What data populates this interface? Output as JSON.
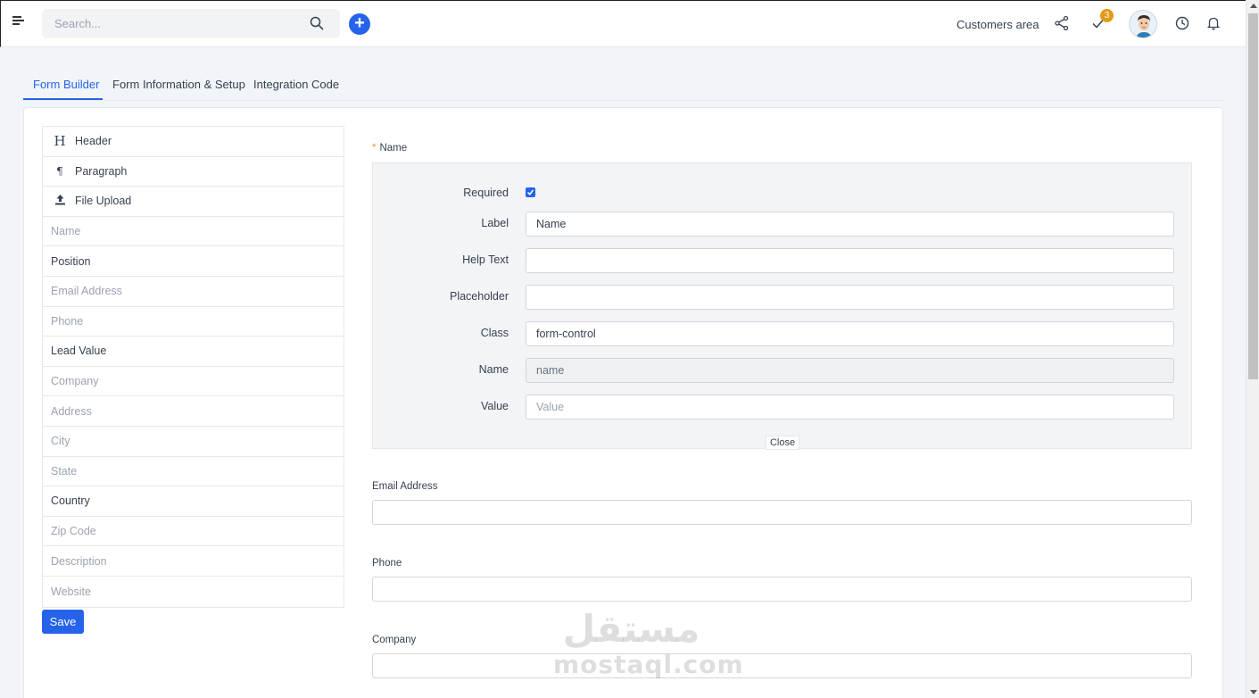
{
  "topbar": {
    "search_placeholder": "Search...",
    "customers_area": "Customers area",
    "tasks_badge": "3"
  },
  "tabs": [
    {
      "label": "Form Builder",
      "active": true
    },
    {
      "label": "Form Information & Setup",
      "active": false
    },
    {
      "label": "Integration Code",
      "active": false
    }
  ],
  "fields": [
    {
      "label": "Header",
      "icon": "header-icon",
      "style": "dark"
    },
    {
      "label": "Paragraph",
      "icon": "paragraph-icon",
      "style": "dark"
    },
    {
      "label": "File Upload",
      "icon": "upload-icon",
      "style": "dark"
    },
    {
      "label": "Name",
      "style": "light"
    },
    {
      "label": "Position",
      "style": "dark"
    },
    {
      "label": "Email Address",
      "style": "light"
    },
    {
      "label": "Phone",
      "style": "light"
    },
    {
      "label": "Lead Value",
      "style": "dark"
    },
    {
      "label": "Company",
      "style": "light"
    },
    {
      "label": "Address",
      "style": "light"
    },
    {
      "label": "City",
      "style": "light"
    },
    {
      "label": "State",
      "style": "light"
    },
    {
      "label": "Country",
      "style": "dark"
    },
    {
      "label": "Zip Code",
      "style": "light"
    },
    {
      "label": "Description",
      "style": "light"
    },
    {
      "label": "Website",
      "style": "light"
    }
  ],
  "save_label": "Save",
  "editor": {
    "field_title": "Name",
    "required_star": "*",
    "required_label": "Required",
    "required_checked": true,
    "label_label": "Label",
    "label_value": "Name",
    "help_text_label": "Help Text",
    "help_text_value": "",
    "placeholder_label": "Placeholder",
    "placeholder_value": "",
    "class_label": "Class",
    "class_value": "form-control",
    "name_label": "Name",
    "name_value": "name",
    "value_label": "Value",
    "value_placeholder": "Value",
    "close_label": "Close"
  },
  "form_fields": [
    {
      "label": "Email Address"
    },
    {
      "label": "Phone"
    },
    {
      "label": "Company"
    }
  ],
  "watermark": {
    "arabic": "مستقل",
    "latin": "mostaql.com"
  },
  "colors": {
    "accent": "#2563eb",
    "badge": "#e29a17"
  }
}
